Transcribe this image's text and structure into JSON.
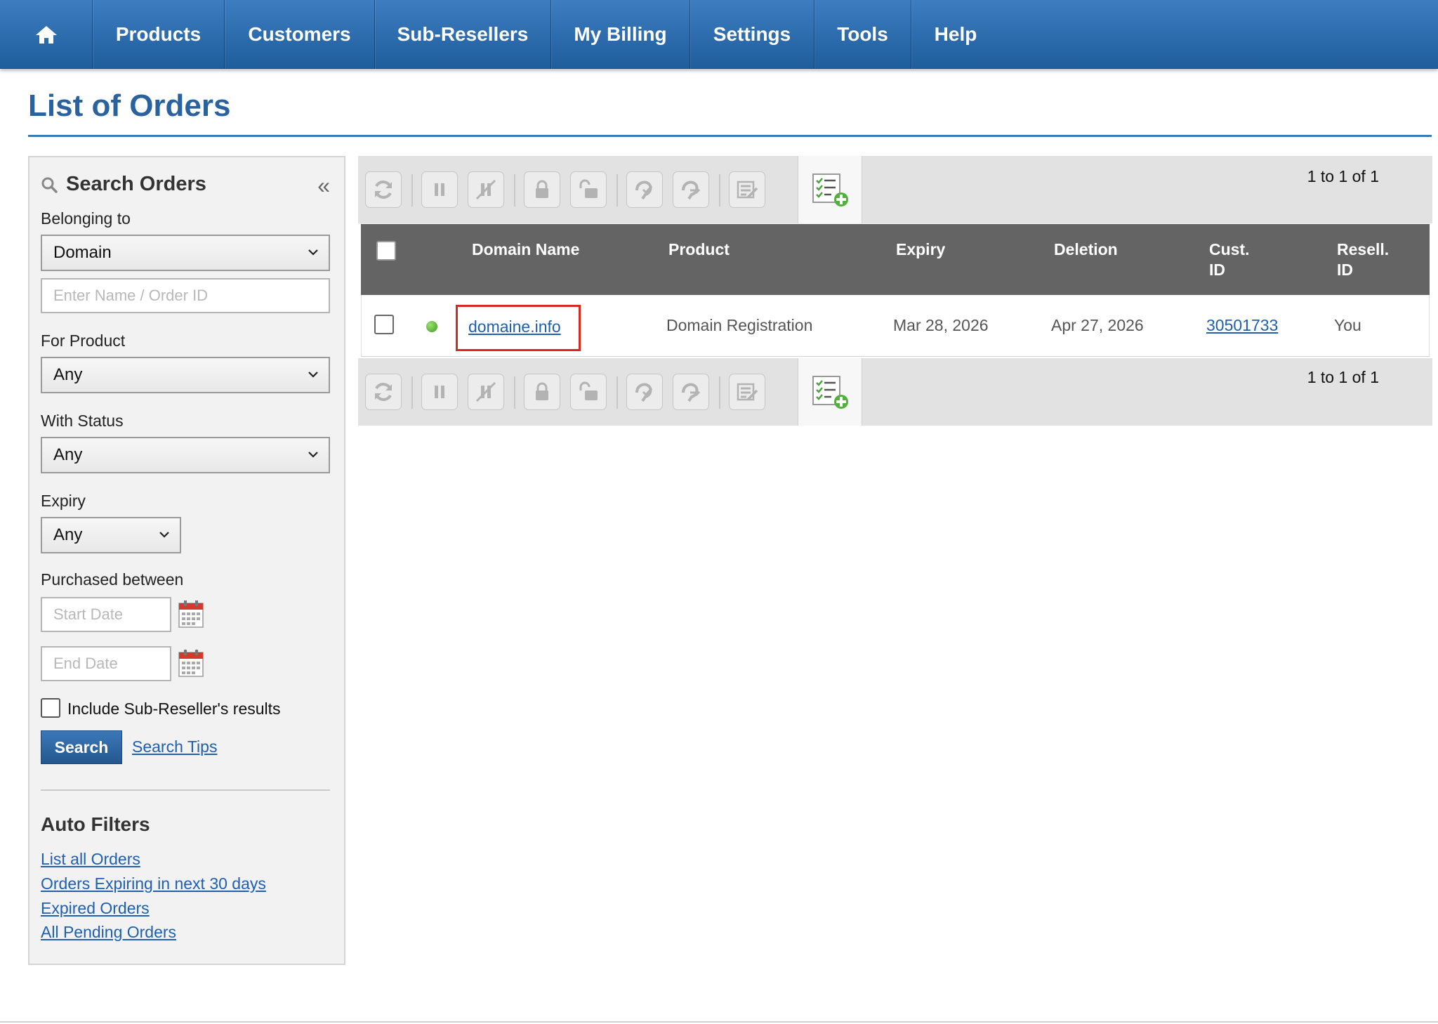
{
  "nav": {
    "items": [
      {
        "label": "Products"
      },
      {
        "label": "Customers"
      },
      {
        "label": "Sub-Resellers"
      },
      {
        "label": "My Billing"
      },
      {
        "label": "Settings"
      },
      {
        "label": "Tools"
      },
      {
        "label": "Help"
      }
    ]
  },
  "page": {
    "title": "List of Orders"
  },
  "sidebar": {
    "title": "Search Orders",
    "belonging_label": "Belonging to",
    "belonging_value": "Domain",
    "name_placeholder": "Enter Name / Order ID",
    "product_label": "For Product",
    "product_value": "Any",
    "status_label": "With Status",
    "status_value": "Any",
    "expiry_label": "Expiry",
    "expiry_value": "Any",
    "purchased_label": "Purchased between",
    "start_placeholder": "Start Date",
    "end_placeholder": "End Date",
    "include_sub_label": "Include Sub-Reseller's results",
    "search_button": "Search",
    "search_tips": "Search Tips",
    "auto_filters_title": "Auto Filters",
    "auto_filters": [
      {
        "label": "List all Orders"
      },
      {
        "label": "Orders Expiring in next 30 days"
      },
      {
        "label": "Expired Orders"
      },
      {
        "label": "All Pending Orders"
      }
    ]
  },
  "pager": {
    "text": "1 to 1 of 1"
  },
  "table": {
    "headers": {
      "domain": "Domain Name",
      "product": "Product",
      "expiry": "Expiry",
      "deletion": "Deletion",
      "cust_1": "Cust.",
      "cust_2": "ID",
      "resell_1": "Resell.",
      "resell_2": "ID"
    },
    "rows": [
      {
        "domain": "domaine.info",
        "product": "Domain Registration",
        "expiry": "Mar 28, 2026",
        "deletion": "Apr 27, 2026",
        "cust_id": "30501733",
        "resell_id": "You"
      }
    ]
  },
  "icons": {
    "toolbar": [
      "renew-icon",
      "suspend-icon",
      "unsuspend-icon",
      "lock-icon",
      "unlock-icon",
      "privacy-on-icon",
      "privacy-off-icon",
      "modify-icon",
      "add-order-icon"
    ]
  },
  "colors": {
    "nav_top": "#3d7dc0",
    "nav_bottom": "#1f5d9c",
    "title": "#2a62a0",
    "link": "#1f5fb0",
    "header_bg": "#646464",
    "highlight": "#d32b1f",
    "status_active": "#3c9a22"
  }
}
